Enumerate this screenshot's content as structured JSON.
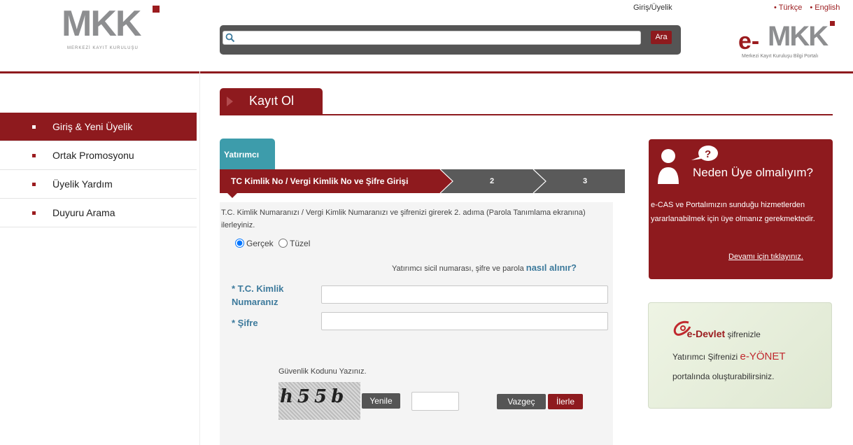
{
  "header": {
    "logo_text": "MKK",
    "logo_subtitle": "MERKEZİ KAYIT KURULUŞU",
    "login_link": "Giriş/Üyelik",
    "languages": [
      "• Türkçe",
      "• English"
    ],
    "search": {
      "value": "",
      "button": "Ara"
    },
    "emkk_e": "e-",
    "emkk_mark": "MKK",
    "emkk_subtitle": "Merkezi Kayıt Kuruluşu Bilgi Portalı"
  },
  "sidebar": {
    "items": [
      {
        "label": "Giriş & Yeni Üyelik",
        "active": true
      },
      {
        "label": "Ortak Promosyonu",
        "active": false
      },
      {
        "label": "Üyelik Yardım",
        "active": false
      },
      {
        "label": "Duyuru Arama",
        "active": false
      }
    ]
  },
  "page": {
    "title": "Kayıt Ol",
    "tab": "Yatırımcı",
    "steps": [
      "TC Kimlik No / Vergi Kimlik No ve Şifre Girişi",
      "2",
      "3"
    ],
    "intro": "T.C. Kimlik Numaranızı / Vergi Kimlik Numaranızı ve şifrenizi girerek 2. adıma (Parola Tanımlama ekranına) ilerleyiniz.",
    "radio_options": [
      {
        "label": "Gerçek",
        "checked": true
      },
      {
        "label": "Tüzel",
        "checked": false
      }
    ],
    "hint_text": "Yatırımcı sicil numarası, şifre ve parola",
    "hint_link": "nasıl alınır?",
    "tc_label": "* T.C. Kimlik Numaranız",
    "tc_value": "",
    "password_label": "* Şifre",
    "password_value": "",
    "captcha_label": "Güvenlik Kodunu Yazınız.",
    "captcha_code": "h55b",
    "captcha_value": "",
    "refresh_button": "Yenile",
    "cancel_button": "Vazgeç",
    "next_button": "İlerle"
  },
  "why_box": {
    "title": "Neden Üye olmalıyım?",
    "text": "e-CAS ve Portalımızın sunduğu hizmetlerden yararlanabilmek için üye olmanız gerekmektedir.",
    "more_link": "Devamı için tıklayınız."
  },
  "edevlet_box": {
    "brand": "e-Devlet",
    "line1_suffix": "şifrenizle",
    "line2_prefix": "Yatırımcı Şifrenizi",
    "line2_brand": "e-YÖNET",
    "line3": "portalında oluşturabilirsiniz."
  },
  "colors": {
    "brand": "#8e1a1e",
    "teal": "#3d9cab",
    "link": "#3d7a9c"
  }
}
